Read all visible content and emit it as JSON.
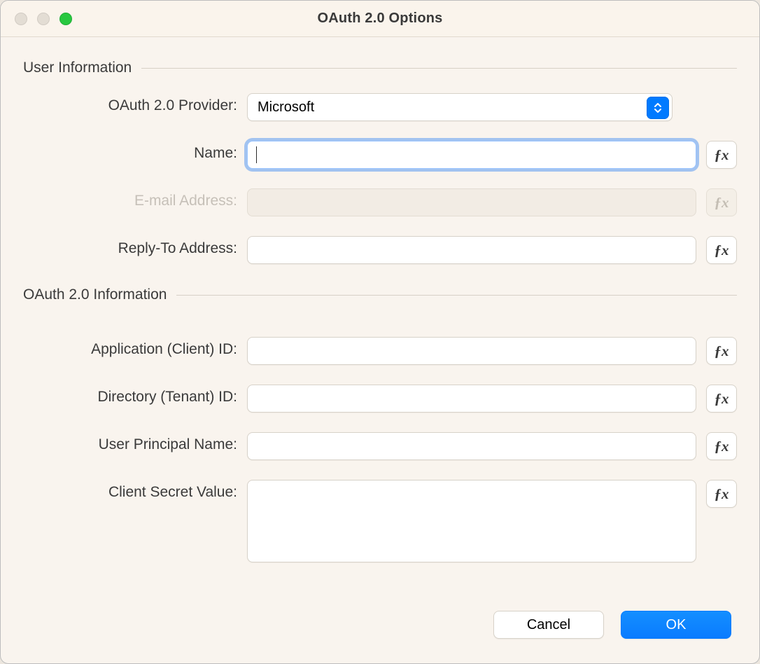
{
  "window": {
    "title": "OAuth 2.0 Options"
  },
  "sections": {
    "user_info": {
      "title": "User Information"
    },
    "oauth_info": {
      "title": "OAuth 2.0 Information"
    }
  },
  "fields": {
    "provider": {
      "label": "OAuth 2.0 Provider:",
      "value": "Microsoft"
    },
    "name": {
      "label": "Name:",
      "value": ""
    },
    "email": {
      "label": "E-mail Address:",
      "value": ""
    },
    "replyto": {
      "label": "Reply-To Address:",
      "value": ""
    },
    "client_id": {
      "label": "Application (Client) ID:",
      "value": ""
    },
    "tenant_id": {
      "label": "Directory (Tenant) ID:",
      "value": ""
    },
    "upn": {
      "label": "User Principal Name:",
      "value": ""
    },
    "secret": {
      "label": "Client Secret Value:",
      "value": ""
    }
  },
  "fx_label": "ƒx",
  "buttons": {
    "cancel": "Cancel",
    "ok": "OK"
  }
}
